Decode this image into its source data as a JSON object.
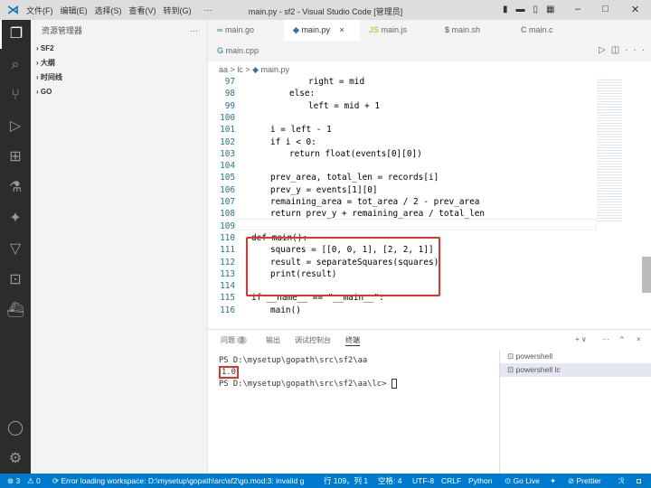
{
  "titlebar": {
    "menus": [
      "文件(F)",
      "编辑(E)",
      "选择(S)",
      "查看(V)",
      "转到(G)",
      "···"
    ],
    "title": "main.py - sf2 - Visual Studio Code [管理员]"
  },
  "sidebar": {
    "header": "资源管理器",
    "more": "···",
    "items": [
      "SF2",
      "大纲",
      "时间线",
      "GO"
    ]
  },
  "tabs": [
    {
      "label": "main.go",
      "icon": "∞",
      "color": "#519aba"
    },
    {
      "label": "main.py",
      "icon": "◆",
      "color": "#3572a5",
      "active": true
    },
    {
      "label": "main.js",
      "icon": "JS",
      "color": "#cbcb41"
    },
    {
      "label": "main.sh",
      "icon": "$",
      "color": "#4d9a4d"
    },
    {
      "label": "main.c",
      "icon": "C",
      "color": "#519aba"
    },
    {
      "label": "main.cpp",
      "icon": "G",
      "color": "#519aba"
    }
  ],
  "breadcrumb": [
    "aa",
    ">",
    "lc",
    ">",
    "main.py"
  ],
  "code": [
    {
      "n": "97",
      "t": "right = mid",
      "i": 3
    },
    {
      "n": "98",
      "t": "else:",
      "i": 2,
      "kw": true
    },
    {
      "n": "99",
      "t": "left = mid + 1",
      "i": 3
    },
    {
      "n": "100",
      "t": "",
      "i": 0
    },
    {
      "n": "101",
      "t": "i = left - 1",
      "i": 1
    },
    {
      "n": "102",
      "t": "if i < 0:",
      "i": 1
    },
    {
      "n": "103",
      "t": "return float(events[0][0])",
      "i": 2
    },
    {
      "n": "104",
      "t": "",
      "i": 0
    },
    {
      "n": "105",
      "t": "prev_area, total_len = records[i]",
      "i": 1
    },
    {
      "n": "106",
      "t": "prev_y = events[1][0]",
      "i": 1
    },
    {
      "n": "107",
      "t": "remaining_area = tot_area / 2 - prev_area",
      "i": 1
    },
    {
      "n": "108",
      "t": "return prev_y + remaining_area / total_len",
      "i": 1
    },
    {
      "n": "109",
      "t": "",
      "i": 0
    },
    {
      "n": "110",
      "t": "def main():",
      "i": 0
    },
    {
      "n": "111",
      "t": "squares = [[0, 0, 1], [2, 2, 1]]",
      "i": 1
    },
    {
      "n": "112",
      "t": "result = separateSquares(squares)",
      "i": 1
    },
    {
      "n": "113",
      "t": "print(result)",
      "i": 1
    },
    {
      "n": "114",
      "t": "",
      "i": 0
    },
    {
      "n": "115",
      "t": "if __name__ == \"__main__\":",
      "i": 0
    },
    {
      "n": "116",
      "t": "main()",
      "i": 1
    }
  ],
  "panel": {
    "tabs": [
      "问题",
      "输出",
      "调试控制台",
      "终端"
    ],
    "problem_count": "3",
    "terminal": [
      "PS D:\\mysetup\\gopath\\src\\sf2\\aa",
      "1.0",
      "PS D:\\mysetup\\gopath\\src\\sf2\\aa\\lc> "
    ],
    "terminals": [
      "powershell",
      "powershell lc"
    ],
    "actions": [
      "+ ∨",
      "···",
      "^",
      "×"
    ]
  },
  "status": {
    "errors": "⊗ 3",
    "warnings": "⚠ 0",
    "message": "Error loading workspace: D:\\mysetup\\gopath\\src\\sf2\\go.mod:3: invalid g",
    "position": "行 109，列 1",
    "spaces": "空格: 4",
    "encoding": "UTF-8",
    "eol": "CRLF",
    "language": "Python",
    "golive": "Go Live",
    "prettier": "⊘ Prettier"
  }
}
